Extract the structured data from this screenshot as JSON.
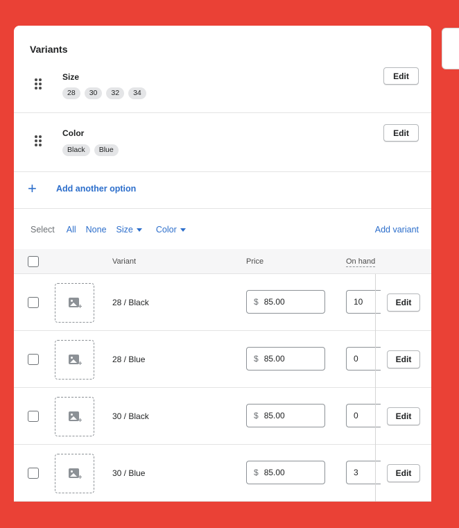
{
  "section_title": "Variants",
  "options": [
    {
      "name": "Size",
      "values": [
        "28",
        "30",
        "32",
        "34"
      ],
      "edit_label": "Edit"
    },
    {
      "name": "Color",
      "values": [
        "Black",
        "Blue"
      ],
      "edit_label": "Edit"
    }
  ],
  "add_option_label": "Add another option",
  "select_bar": {
    "label": "Select",
    "all": "All",
    "none": "None",
    "size": "Size",
    "color": "Color",
    "add_variant": "Add variant"
  },
  "table": {
    "headers": {
      "variant": "Variant",
      "price": "Price",
      "on_hand": "On hand"
    },
    "rows": [
      {
        "variant": "28 / Black",
        "currency": "$",
        "price": "85.00",
        "on_hand": "10",
        "edit_label": "Edit"
      },
      {
        "variant": "28 / Blue",
        "currency": "$",
        "price": "85.00",
        "on_hand": "0",
        "edit_label": "Edit"
      },
      {
        "variant": "30 / Black",
        "currency": "$",
        "price": "85.00",
        "on_hand": "0",
        "edit_label": "Edit"
      },
      {
        "variant": "30 / Blue",
        "currency": "$",
        "price": "85.00",
        "on_hand": "3",
        "edit_label": "Edit"
      }
    ]
  },
  "colors": {
    "background": "#ea4136",
    "link": "#2c6ecb",
    "tag": "#e4e5e7"
  },
  "icons": [
    "drag-handle-icon",
    "plus-icon",
    "caret-down-icon",
    "image-add-icon"
  ]
}
